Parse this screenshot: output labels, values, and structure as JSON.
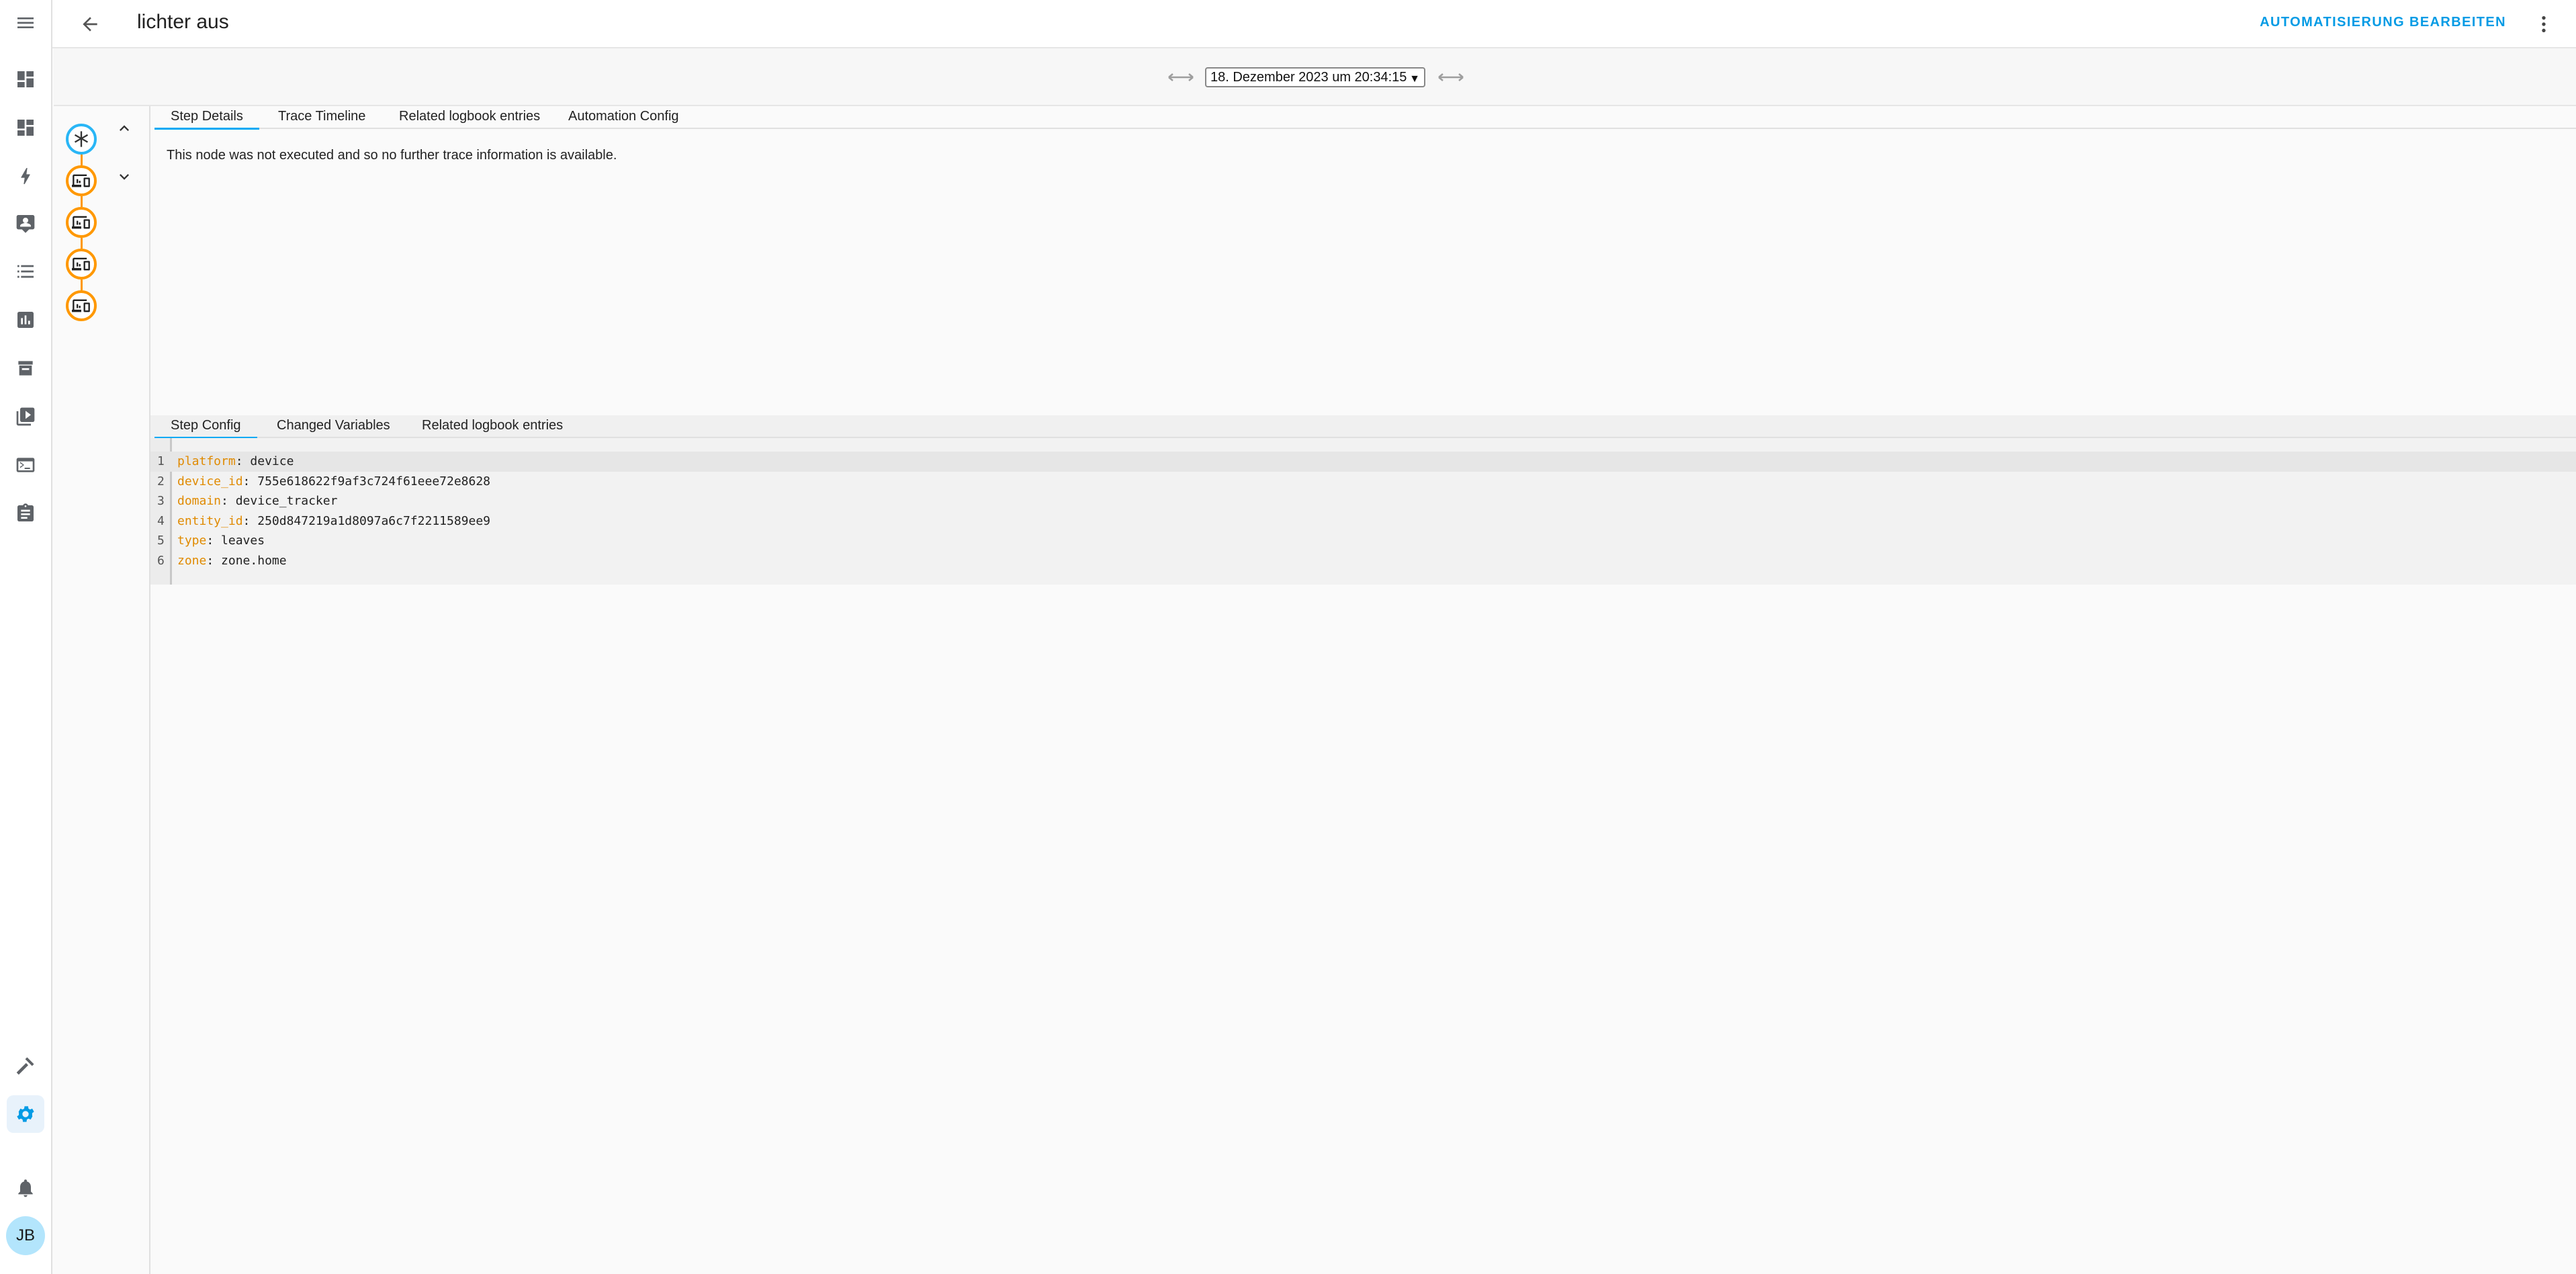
{
  "header": {
    "title": "lichter aus",
    "edit_label": "AUTOMATISIERUNG BEARBEITEN"
  },
  "trace_picker": {
    "selected": "18. Dezember 2023 um 20:34:15"
  },
  "sidebar": {
    "items": [
      "menu-icon",
      "dashboard-icon",
      "dashboard-icon",
      "lightning-icon",
      "person-board-icon",
      "list-icon",
      "chart-icon",
      "hacs-icon",
      "media-icon",
      "terminal-icon",
      "clipboard-icon",
      "hammer-icon",
      "gear-icon",
      "bell-icon"
    ],
    "user_initials": "JB",
    "accent_color": "#039be5"
  },
  "graph": {
    "nodes": [
      "trigger",
      "device-action",
      "device-action",
      "device-action",
      "device-action"
    ],
    "trigger_color": "#29b6f6",
    "action_color": "#ff9800"
  },
  "main_tabs": [
    {
      "label": "Step Details",
      "active": true
    },
    {
      "label": "Trace Timeline",
      "active": false
    },
    {
      "label": "Related logbook entries",
      "active": false
    },
    {
      "label": "Automation Config",
      "active": false
    }
  ],
  "step_details": {
    "message": "This node was not executed and so no further trace information is available."
  },
  "sub_tabs": [
    {
      "label": "Step Config",
      "active": true
    },
    {
      "label": "Changed Variables",
      "active": false
    },
    {
      "label": "Related logbook entries",
      "active": false
    }
  ],
  "step_config": {
    "lines": [
      {
        "n": "1",
        "key": "platform",
        "value": "device"
      },
      {
        "n": "2",
        "key": "device_id",
        "value": "755e618622f9af3c724f61eee72e8628"
      },
      {
        "n": "3",
        "key": "domain",
        "value": "device_tracker"
      },
      {
        "n": "4",
        "key": "entity_id",
        "value": "250d847219a1d8097a6c7f2211589ee9"
      },
      {
        "n": "5",
        "key": "type",
        "value": "leaves"
      },
      {
        "n": "6",
        "key": "zone",
        "value": "zone.home"
      }
    ]
  }
}
